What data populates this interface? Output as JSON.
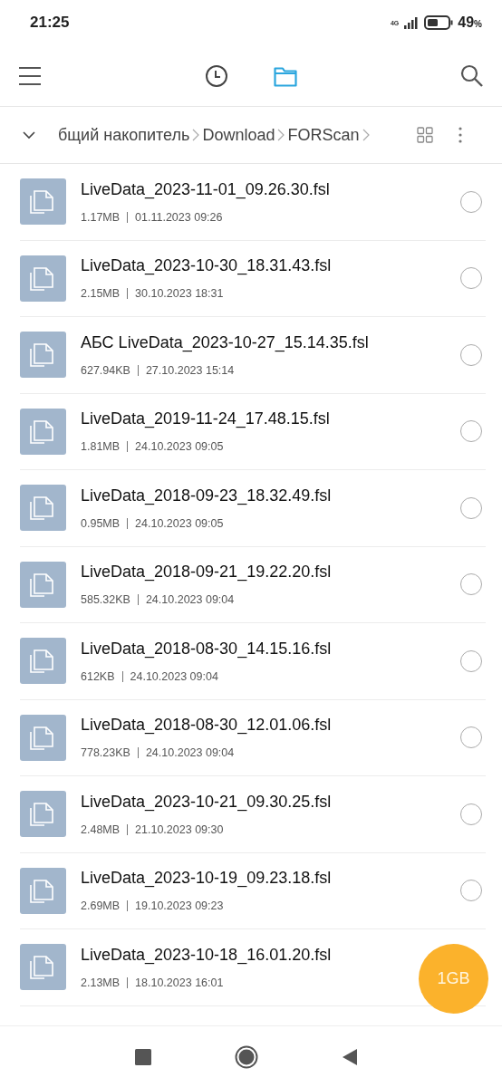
{
  "status_bar": {
    "time": "21:25",
    "network": "4G",
    "battery_percent": "49",
    "percent_sign": "%"
  },
  "toolbar": {
    "tabs": [
      {
        "kind": "recent",
        "selected": false
      },
      {
        "kind": "files",
        "selected": true
      }
    ]
  },
  "breadcrumb": {
    "parts": [
      "бщий накопитель",
      "Download",
      "FORScan"
    ]
  },
  "files": [
    {
      "name": "LiveData_2023-11-01_09.26.30.fsl",
      "size": "1.17MB",
      "date": "01.11.2023 09:26",
      "checked": false
    },
    {
      "name": "LiveData_2023-10-30_18.31.43.fsl",
      "size": "2.15MB",
      "date": "30.10.2023 18:31",
      "checked": false
    },
    {
      "name": "АБС LiveData_2023-10-27_15.14.35.fsl",
      "size": "627.94KB",
      "date": "27.10.2023 15:14",
      "checked": false
    },
    {
      "name": "LiveData_2019-11-24_17.48.15.fsl",
      "size": "1.81MB",
      "date": "24.10.2023 09:05",
      "checked": false
    },
    {
      "name": "LiveData_2018-09-23_18.32.49.fsl",
      "size": "0.95MB",
      "date": "24.10.2023 09:05",
      "checked": false
    },
    {
      "name": "LiveData_2018-09-21_19.22.20.fsl",
      "size": "585.32KB",
      "date": "24.10.2023 09:04",
      "checked": false
    },
    {
      "name": "LiveData_2018-08-30_14.15.16.fsl",
      "size": "612KB",
      "date": "24.10.2023 09:04",
      "checked": false
    },
    {
      "name": "LiveData_2018-08-30_12.01.06.fsl",
      "size": "778.23KB",
      "date": "24.10.2023 09:04",
      "checked": false
    },
    {
      "name": "LiveData_2023-10-21_09.30.25.fsl",
      "size": "2.48MB",
      "date": "21.10.2023 09:30",
      "checked": false
    },
    {
      "name": "LiveData_2023-10-19_09.23.18.fsl",
      "size": "2.69MB",
      "date": "19.10.2023 09:23",
      "checked": false
    },
    {
      "name": "LiveData_2023-10-18_16.01.20.fsl",
      "size": "2.13MB",
      "date": "18.10.2023 16:01"
    }
  ],
  "storage_button": {
    "label": "1GB"
  }
}
